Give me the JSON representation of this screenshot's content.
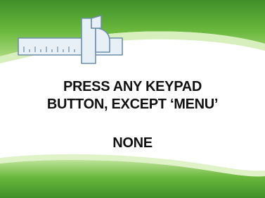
{
  "prompt": {
    "line1": "PRESS ANY KEYPAD",
    "line2": "BUTTON, EXCEPT ‘MENU’"
  },
  "status": {
    "value": "NONE"
  },
  "theme": {
    "green_dark": "#3f8f2a",
    "green_mid": "#6ab83d",
    "green_light": "#b9e28f",
    "accent_blue": "#bcd6ea",
    "text": "#111111"
  },
  "icons": [
    "caliper-icon"
  ]
}
